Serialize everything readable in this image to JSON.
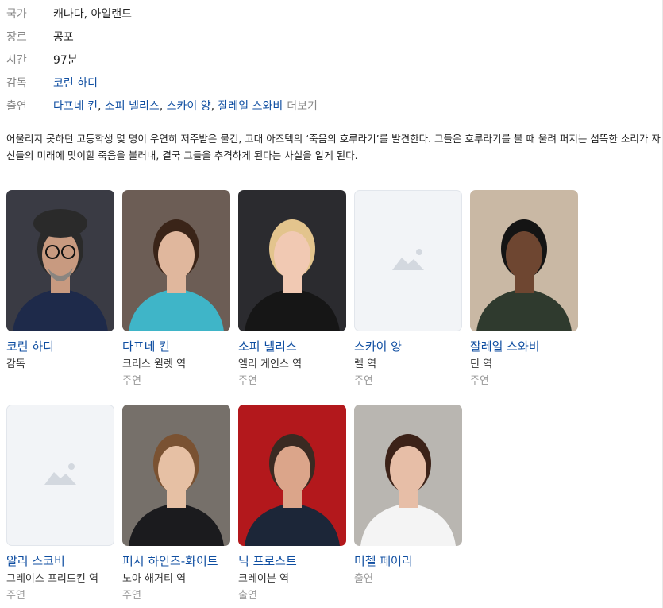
{
  "info": {
    "country": {
      "label": "국가",
      "value": "캐나다, 아일랜드"
    },
    "genre": {
      "label": "장르",
      "value": "공포"
    },
    "runtime": {
      "label": "시간",
      "value": "97분"
    },
    "director": {
      "label": "감독",
      "value": "코린 하디"
    },
    "cast": {
      "label": "출연",
      "names": [
        "다프네 킨",
        "소피 넬리스",
        "스카이 양",
        "잘레일 스와비"
      ],
      "more": "더보기"
    }
  },
  "description": "어울리지 못하던 고등학생 몇 명이 우연히 저주받은 물건, 고대 아즈텍의 ‘죽음의 호루라기’를 발견한다. 그들은 호루라기를 불 때 울려 퍼지는 섬뜩한 소리가 자신들의 미래에 맞이할 죽음을 불러내, 결국 그들을 추격하게 된다는 사실을 알게 된다.",
  "people": [
    {
      "name": "코린 하디",
      "role": "감독",
      "type": "",
      "photo": "director",
      "colors": {
        "bg": "#3a3b44",
        "skin": "#c89a80",
        "hair": "#2a2a2a",
        "shirt": "#1e2a4a"
      }
    },
    {
      "name": "다프네 킨",
      "role": "크리스 윌렛 역",
      "type": "주연",
      "photo": "person",
      "colors": {
        "bg": "#6c5d55",
        "skin": "#e0b79d",
        "hair": "#3a2418",
        "shirt": "#3fb5c8"
      }
    },
    {
      "name": "소피 넬리스",
      "role": "엘리 게인스 역",
      "type": "주연",
      "photo": "person",
      "colors": {
        "bg": "#2b2b2f",
        "skin": "#f1c9b3",
        "hair": "#e3c48d",
        "shirt": "#161616"
      }
    },
    {
      "name": "스카이 양",
      "role": "렐 역",
      "type": "주연",
      "photo": "placeholder",
      "colors": {}
    },
    {
      "name": "잘레일 스와비",
      "role": "딘 역",
      "type": "주연",
      "photo": "person",
      "colors": {
        "bg": "#c9b8a4",
        "skin": "#6e4631",
        "hair": "#141414",
        "shirt": "#2f3a2e"
      }
    },
    {
      "name": "알리 스코비",
      "role": "그레이스 프리드킨 역",
      "type": "주연",
      "photo": "placeholder",
      "colors": {}
    },
    {
      "name": "퍼시 하인즈-화이트",
      "role": "노아 해거티 역",
      "type": "주연",
      "photo": "person",
      "colors": {
        "bg": "#76706a",
        "skin": "#e6c0a4",
        "hair": "#7a5232",
        "shirt": "#1b1b1e"
      }
    },
    {
      "name": "닉 프로스트",
      "role": "크레이븐 역",
      "type": "출연",
      "photo": "person",
      "colors": {
        "bg": "#b3181c",
        "skin": "#dba58a",
        "hair": "#3a2a22",
        "shirt": "#1c2638"
      }
    },
    {
      "name": "미첼 페어리",
      "role": "출연",
      "type": "",
      "photo": "person",
      "colors": {
        "bg": "#b9b6b1",
        "skin": "#e7bea7",
        "hair": "#3c2218",
        "shirt": "#f4f4f4"
      }
    }
  ]
}
